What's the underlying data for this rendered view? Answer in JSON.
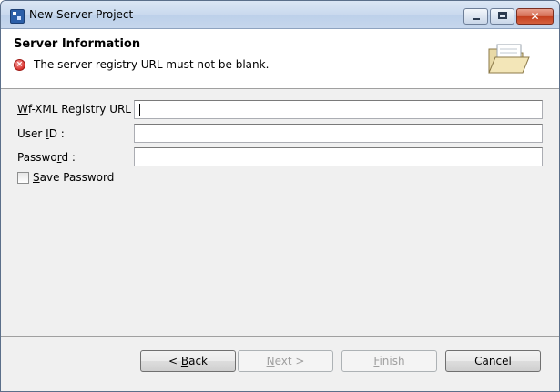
{
  "window": {
    "title": "New Server Project",
    "icon": "eclipse-app-icon"
  },
  "header": {
    "title": "Server Information",
    "message": "The server registry URL must not be blank.",
    "message_icon": "error-icon",
    "banner_icon": "open-folder-icon"
  },
  "form": {
    "registry_url": {
      "label_accel": "W",
      "label_rest": "f-XML Registry URL :",
      "value": ""
    },
    "user_id": {
      "label_pre": "User ",
      "label_accel": "I",
      "label_rest": "D :",
      "value": ""
    },
    "password": {
      "label_pre": "Passwo",
      "label_accel": "r",
      "label_rest": "d :",
      "value": ""
    },
    "save_password": {
      "label_accel": "S",
      "label_rest": "ave Password",
      "checked": false
    }
  },
  "buttons": {
    "back": {
      "pre": "< ",
      "accel": "B",
      "rest": "ack"
    },
    "next": {
      "accel": "N",
      "rest": "ext >"
    },
    "finish": {
      "accel": "F",
      "rest": "inish"
    },
    "cancel": "Cancel"
  }
}
